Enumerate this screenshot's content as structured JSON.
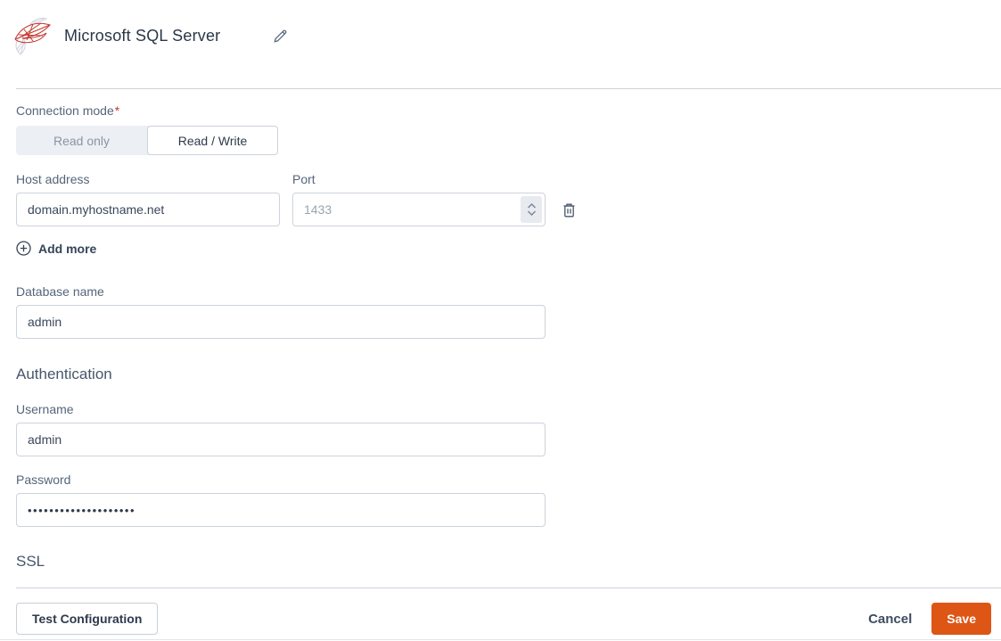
{
  "header": {
    "title": "Microsoft SQL Server",
    "logo_icon": "sql-server-logo",
    "edit_icon": "pencil-icon"
  },
  "connection_mode": {
    "label": "Connection mode",
    "required_marker": "*",
    "options": [
      {
        "label": "Read only",
        "selected": false
      },
      {
        "label": "Read / Write",
        "selected": true
      }
    ]
  },
  "host": {
    "label": "Host address",
    "value": "domain.myhostname.net"
  },
  "port": {
    "label": "Port",
    "placeholder": "1433"
  },
  "add_more": {
    "label": "Add more"
  },
  "database": {
    "label": "Database name",
    "value": "admin"
  },
  "authentication": {
    "heading": "Authentication",
    "username": {
      "label": "Username",
      "value": "admin"
    },
    "password": {
      "label": "Password",
      "value": "••••••••••••••••••••"
    }
  },
  "ssl": {
    "heading": "SSL"
  },
  "footer": {
    "test_button": "Test Configuration",
    "cancel_button": "Cancel",
    "save_button": "Save"
  },
  "colors": {
    "accent_orange": "#de5615",
    "required_red": "#d23030",
    "logo_red": "#c4342b",
    "text_dark": "#2e3a4d",
    "label_gray": "#55657a",
    "placeholder_gray": "#9aa5b1",
    "border_gray": "#ccd3db",
    "toggle_bg": "#eceff3"
  }
}
